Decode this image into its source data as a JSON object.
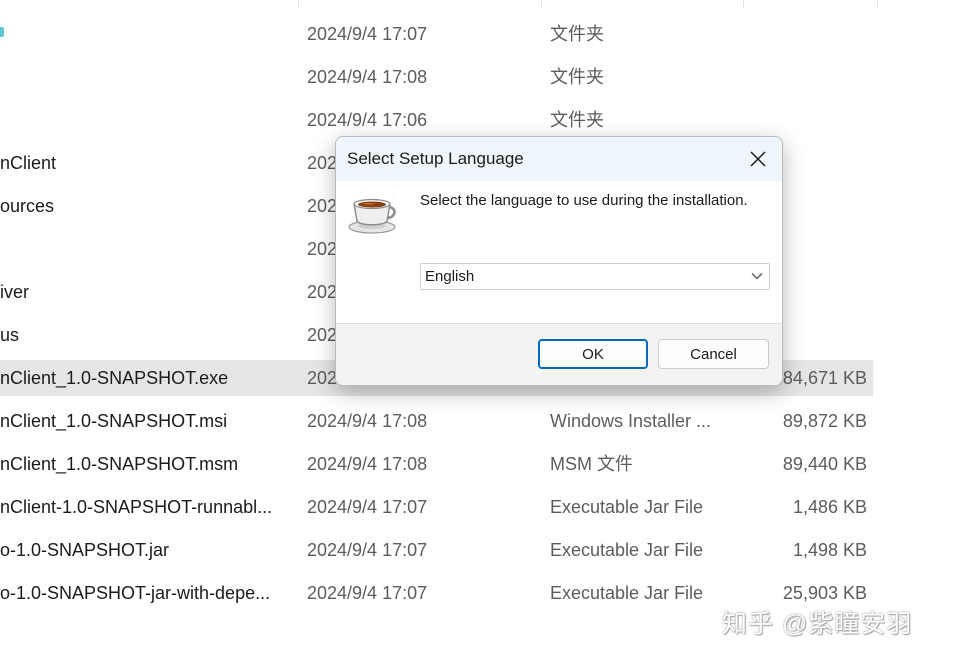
{
  "files": [
    {
      "name": "",
      "date": "2024/9/4 17:07",
      "type": "文件夹",
      "size": ""
    },
    {
      "name": "",
      "date": "2024/9/4 17:08",
      "type": "文件夹",
      "size": ""
    },
    {
      "name": "",
      "date": "2024/9/4 17:06",
      "type": "文件夹",
      "size": ""
    },
    {
      "name": "nClient",
      "date": "202",
      "type": "",
      "size": ""
    },
    {
      "name": "ources",
      "date": "202",
      "type": "",
      "size": ""
    },
    {
      "name": "",
      "date": "202",
      "type": "",
      "size": ""
    },
    {
      "name": "iver",
      "date": "202",
      "type": "",
      "size": ""
    },
    {
      "name": "us",
      "date": "202",
      "type": "",
      "size": ""
    },
    {
      "name": "nClient_1.0-SNAPSHOT.exe",
      "date": "2024",
      "type": "",
      "size": "84,671 KB",
      "selected": true
    },
    {
      "name": "nClient_1.0-SNAPSHOT.msi",
      "date": "2024/9/4 17:08",
      "type": "Windows Installer ...",
      "size": "89,872 KB"
    },
    {
      "name": "nClient_1.0-SNAPSHOT.msm",
      "date": "2024/9/4 17:08",
      "type": "MSM 文件",
      "size": "89,440 KB"
    },
    {
      "name": "nClient-1.0-SNAPSHOT-runnabl...",
      "date": "2024/9/4 17:07",
      "type": "Executable Jar File",
      "size": "1,486 KB"
    },
    {
      "name": "o-1.0-SNAPSHOT.jar",
      "date": "2024/9/4 17:07",
      "type": "Executable Jar File",
      "size": "1,498 KB"
    },
    {
      "name": "o-1.0-SNAPSHOT-jar-with-depe...",
      "date": "2024/9/4 17:07",
      "type": "Executable Jar File",
      "size": "25,903 KB"
    }
  ],
  "dialog": {
    "title": "Select Setup Language",
    "prompt": "Select the language to use during the installation.",
    "language": "English",
    "ok_label": "OK",
    "cancel_label": "Cancel",
    "icon": "setup-teacup-icon"
  },
  "watermark": "知乎 @紫瞳安羽",
  "colors": {
    "selected_row": "#e5e5e5",
    "dialog_titlebar": "#eef6fb",
    "dialog_footer": "#f3f3f3",
    "ok_border": "#0067c0"
  }
}
